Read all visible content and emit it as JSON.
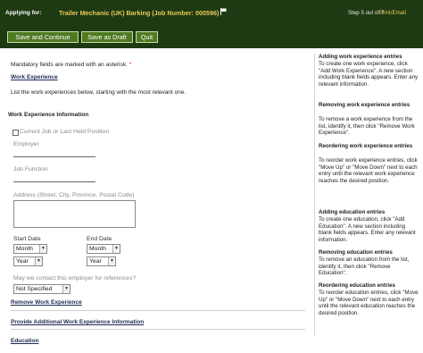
{
  "header": {
    "applying_label": "Applying for:",
    "job_title": "Trailer Mechanic (UK) Barking (Job Number: 000596)",
    "step": "Step 5 out of 7",
    "print_email": "Print/Email"
  },
  "toolbar": {
    "save_continue": "Save and Continue",
    "save_draft": "Save as Draft",
    "quit": "Quit"
  },
  "form": {
    "mandatory_note": "Mandatory fields are marked with an asterisk.",
    "asterisk": "*",
    "section_title": "Work Experience",
    "instructions": "List the work experiences below, starting with the most relevant one.",
    "work_info_title": "Work Experience Information",
    "current_job_label": "Current Job or Last Held Position",
    "employer_label": "Employer",
    "job_function_label": "Job Function",
    "address_label": "Address (Street, City, Province, Postal Code)",
    "start_date_label": "Start Date",
    "end_date_label": "End Date",
    "month_value": "Month",
    "year_value": "Year",
    "references_question": "May we contact this employer for references?",
    "references_value": "Not Specified",
    "remove_link": "Remove Work Experience",
    "add_link": "Provide Additional Work Experience Information",
    "education_title": "Education"
  },
  "help": {
    "adding_title": "Adding work experience entries",
    "adding_text": "To create one work experience, click \"Add Work Experience\". A new section including blank fields appears. Enter any relevant information.",
    "removing_title": "Removing work experience entries",
    "removing_text": "To remove a work experience from the list, identify it, then click \"Remove Work Experience\".",
    "reordering_title": "Reordering work experience entries",
    "reordering_text": "To reorder work experience entries, click \"Move Up\" or \"Move Down\" next to each entry until the relevant work experience reaches the desired position.",
    "add_edu_title": "Adding education entries",
    "add_edu_text": "To create one education, click \"Add Education\". A new section including blank fields appears. Enter any relevant information.",
    "remove_edu_title": "Removing education entries",
    "remove_edu_text": "To remove an education from the list, identify it, then click \"Remove Education\".",
    "reorder_edu_title": "Reordering education entries",
    "reorder_edu_text": "To reorder education entries, click \"Move Up\" or \"Move Down\" next to each entry until the relevant education reaches the desired position."
  },
  "colors": {
    "header_bg": "#1e3a12",
    "button_bg": "#4e7a22",
    "job_title": "#e8c95a",
    "section_link": "#1e2b55"
  },
  "icons": {
    "flag": "flag-icon",
    "select_arrow": "chevron-down-icon"
  }
}
